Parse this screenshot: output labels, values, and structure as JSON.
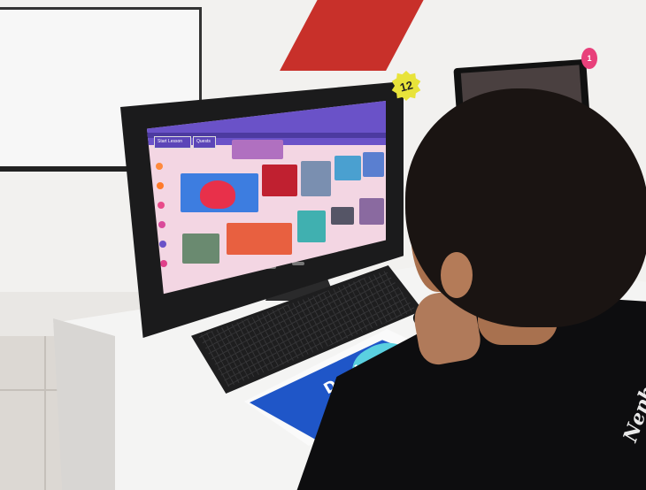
{
  "photo": {
    "station_badge": "12",
    "station_badge_2": "1",
    "screen_buttons": [
      "Start Lesson",
      "Quests"
    ],
    "book_text": "Doub",
    "shirt_text": "Neph"
  },
  "colors": {
    "screen_header": "#6a52c8",
    "screen_bg": "#f3d6e3",
    "book_blue": "#1f56c8",
    "badge_yellow": "#e8e33a",
    "wall_red": "#c8302a"
  }
}
